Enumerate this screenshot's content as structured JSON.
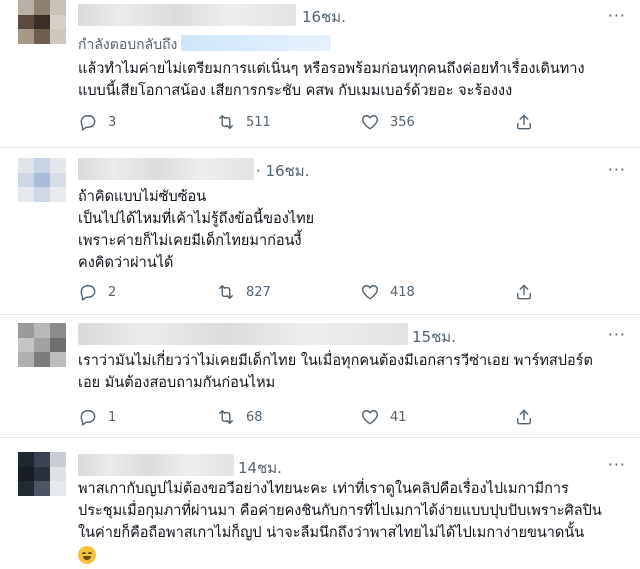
{
  "tweets": [
    {
      "time": "16ชม.",
      "reply_prefix": "กำลังตอบกลับถึง",
      "lines": [
        "แล้วทำไมค่ายไม่เตรียมการแต่เนิ่นๆ หรือรอพร้อมก่อนทุกคนถึงค่อยทำเรื่องเดินทาง",
        "แบบนี้เสียโอกาสน้อง เสียการกระชับ คสพ กับเมมเบอร์ด้วยอะ จะร้องงง"
      ],
      "replies": "3",
      "retweets": "511",
      "likes": "356"
    },
    {
      "time": "· 16ชม.",
      "lines": [
        "ถ้าคิดแบบไม่ซับซ้อน",
        "เป็นไปได้ไหมที่เค้าไม่รู้ถึงข้อนี้ของไทย",
        "เพราะค่ายก็ไม่เคยมีเด็กไทยมาก่อนงี้",
        "คงคิดว่าผ่านได้"
      ],
      "replies": "2",
      "retweets": "827",
      "likes": "418"
    },
    {
      "time": "15ชม.",
      "lines": [
        "เราว่ามันไม่เกี่ยวว่าไม่เคยมีเด็กไทย  ในเมื่อทุกคนต้องมีเอกสารวีซ่าเอย พาร์ทสปอร์ต",
        "เอย มันต้องสอบถามกันก่อนไหม"
      ],
      "replies": "1",
      "retweets": "68",
      "likes": "41"
    },
    {
      "time": "14ชม.",
      "lines": [
        "พาสเกากับญปไม่ต้องขอวีอย่างไทยนะคะ เท่าที่เราดูในคลิปคือเรื่องไปเมกามีการ",
        "ประชุมเมื่อกุมภาที่ผ่านมา คือค่ายคงชินกับการที่ไปเมกาได้ง่ายแบบปุบปับเพราะศิลปิน",
        "ในค่ายก็คือถือพาสเกาไม่ก็ญป น่าจะลืมนึกถึงว่าพาสไทยไม่ได้ไปเมกาง่ายขนาดนั้น"
      ]
    }
  ],
  "icons": {
    "more": "more-icon",
    "reply": "reply-icon",
    "retweet": "retweet-icon",
    "like": "heart-icon",
    "share": "share-icon",
    "emoji": "grinning-sweat-emoji"
  },
  "colors": {
    "text": "#0f1419",
    "muted": "#536471",
    "separator": "#e6e6e6"
  }
}
